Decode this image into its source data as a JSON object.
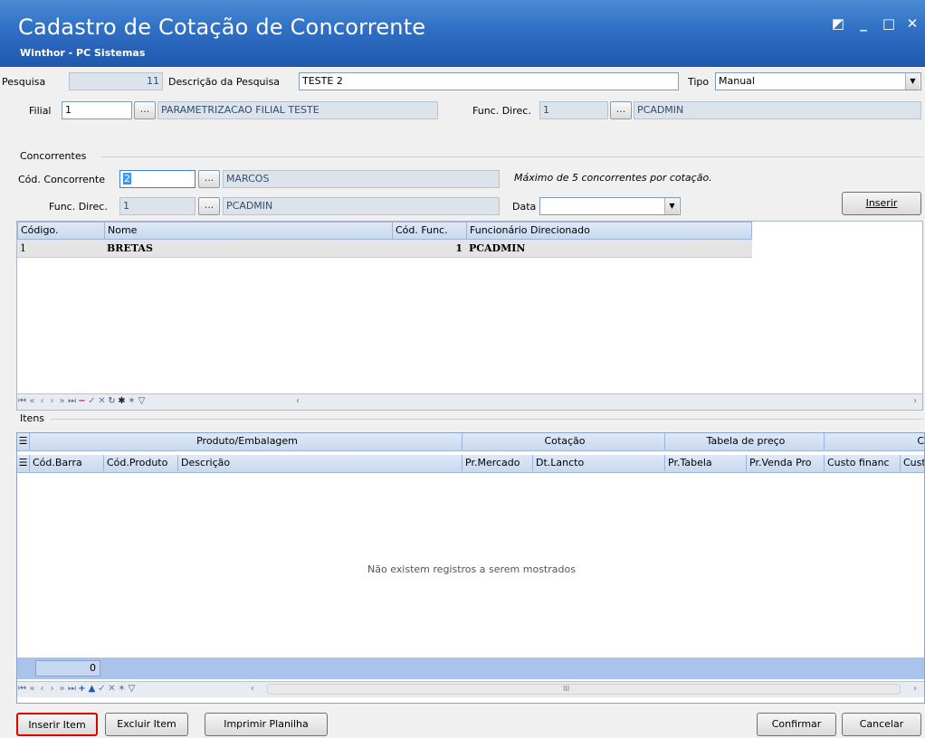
{
  "window": {
    "title": "Cadastro de Cotação de Concorrente",
    "subtitle": "Winthor - PC Sistemas",
    "controls": [
      "◩",
      "_",
      "□",
      "✕"
    ]
  },
  "header": {
    "pesquisa_label": "Pesquisa",
    "pesquisa_value": "11",
    "descricao_label": "Descrição da Pesquisa",
    "descricao_value": "TESTE 2",
    "tipo_label": "Tipo",
    "tipo_value": "Manual",
    "filial_label": "Filial",
    "filial_value": "1",
    "filial_name": "PARAMETRIZACAO FILIAL TESTE",
    "func_label": "Func. Direc.",
    "func_value": "1",
    "func_name": "PCADMIN",
    "dots": "..."
  },
  "concorrentes": {
    "group_label": "Concorrentes",
    "cod_label": "Cód. Concorrente",
    "cod_value": "2",
    "cod_name": "MARCOS",
    "max_note": "Máximo de 5 concorrentes por cotação.",
    "func_label": "Func. Direc.",
    "func_value": "1",
    "func_name": "PCADMIN",
    "data_label": "Data",
    "data_value": "",
    "inserir_label": "Inserir",
    "columns": [
      "Código.",
      "Nome",
      "Cód. Func.",
      "Funcionário Direcionado"
    ],
    "rows": [
      {
        "codigo": "1",
        "nome": "BRETAS",
        "cod_func": "1",
        "funcionario": "PCADMIN"
      }
    ]
  },
  "itens": {
    "group_label": "Itens",
    "band_headers": [
      "Produto/Embalagem",
      "Cotação",
      "Tabela de preço",
      "C"
    ],
    "columns": [
      "Cód.Barra",
      "Cód.Produto",
      "Descrição",
      "Pr.Mercado",
      "Dt.Lancto",
      "Pr.Tabela",
      "Pr.Venda Pro",
      "Custo financ",
      "Cust"
    ],
    "empty_message": "Não existem registros a serem mostrados",
    "footer_count": "0",
    "scroll_grip": "III"
  },
  "buttons": {
    "inserir_item": "Inserir Item",
    "excluir_item": "Excluir Item",
    "imprimir_planilha": "Imprimir Planilha",
    "confirmar": "Confirmar",
    "cancelar": "Cancelar"
  },
  "colors": {
    "title_gradient_top": "#4a8bd6",
    "title_gradient_bottom": "#1f58ad",
    "grid_header": "#c8d9ef",
    "readonly_field": "#dde3ea",
    "highlight_border": "#e00000",
    "footer_band": "#a9c3ec"
  }
}
